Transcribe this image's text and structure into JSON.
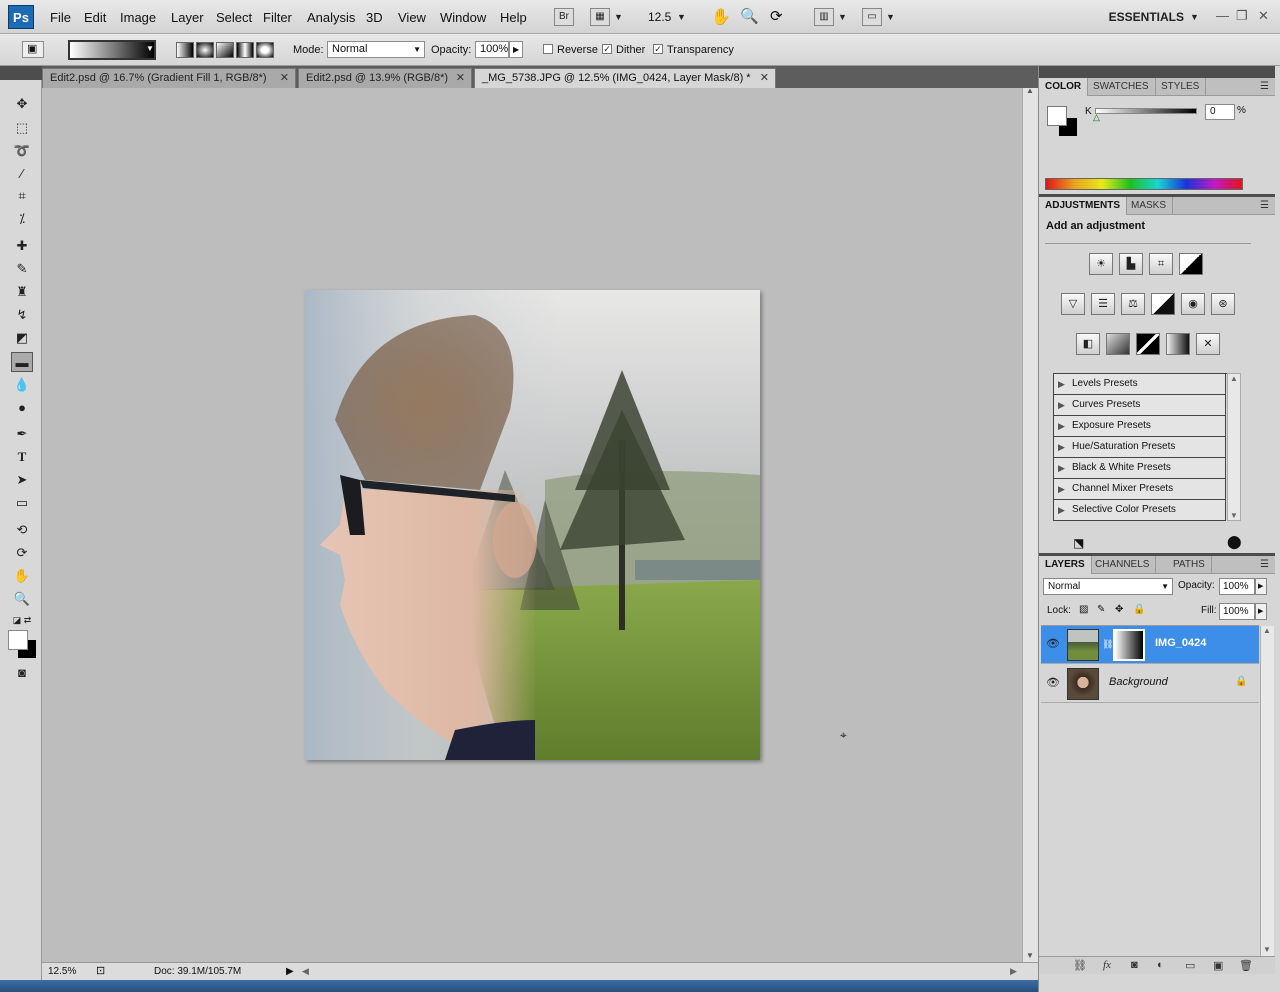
{
  "menubar": {
    "logo": "Ps",
    "items": [
      "File",
      "Edit",
      "Image",
      "Layer",
      "Select",
      "Filter",
      "Analysis",
      "3D",
      "View",
      "Window",
      "Help"
    ],
    "bridge_label": "Br",
    "zoom_value": "12.5",
    "workspace": "ESSENTIALS",
    "window_controls": [
      "—",
      "❐",
      "✕"
    ]
  },
  "options": {
    "mode_label": "Mode:",
    "mode_value": "Normal",
    "opacity_label": "Opacity:",
    "opacity_value": "100%",
    "reverse_label": "Reverse",
    "dither_label": "Dither",
    "transparency_label": "Transparency",
    "reverse_checked": false,
    "dither_checked": true,
    "transparency_checked": true
  },
  "tabs": [
    {
      "label": "Edit2.psd @ 16.7% (Gradient Fill 1, RGB/8*)",
      "active": false
    },
    {
      "label": "Edit2.psd @ 13.9% (RGB/8*)",
      "active": false
    },
    {
      "label": "_MG_5738.JPG @ 12.5% (IMG_0424, Layer Mask/8) *",
      "active": true
    }
  ],
  "status": {
    "zoom": "12.5%",
    "doc": "Doc: 39.1M/105.7M"
  },
  "color_panel": {
    "tabs": [
      "COLOR",
      "SWATCHES",
      "STYLES"
    ],
    "channel": "K",
    "value": "0",
    "unit": "%"
  },
  "adjustments_panel": {
    "tabs": [
      "ADJUSTMENTS",
      "MASKS"
    ],
    "heading": "Add an adjustment",
    "icons_row1": [
      "brightness-contrast-icon",
      "levels-icon",
      "curves-icon",
      "exposure-icon"
    ],
    "icons_row2": [
      "vibrance-icon",
      "hue-saturation-icon",
      "color-balance-icon",
      "black-white-icon",
      "photo-filter-icon",
      "channel-mixer-icon"
    ],
    "icons_row3": [
      "invert-icon",
      "posterize-icon",
      "threshold-icon",
      "gradient-map-icon",
      "selective-color-icon"
    ],
    "presets": [
      "Levels Presets",
      "Curves Presets",
      "Exposure Presets",
      "Hue/Saturation Presets",
      "Black & White Presets",
      "Channel Mixer Presets",
      "Selective Color Presets"
    ]
  },
  "layers_panel": {
    "tabs": [
      "LAYERS",
      "CHANNELS",
      "PATHS"
    ],
    "blend_mode": "Normal",
    "opacity_label": "Opacity:",
    "opacity_value": "100%",
    "lock_label": "Lock:",
    "fill_label": "Fill:",
    "fill_value": "100%",
    "layers": [
      {
        "name": "IMG_0424",
        "selected": true
      },
      {
        "name": "Background",
        "selected": false
      }
    ]
  },
  "colors": {
    "selection_blue": "#3d8ee8",
    "panel_bg": "#d6d6d6",
    "canvas_bg": "#bdbdbd"
  }
}
